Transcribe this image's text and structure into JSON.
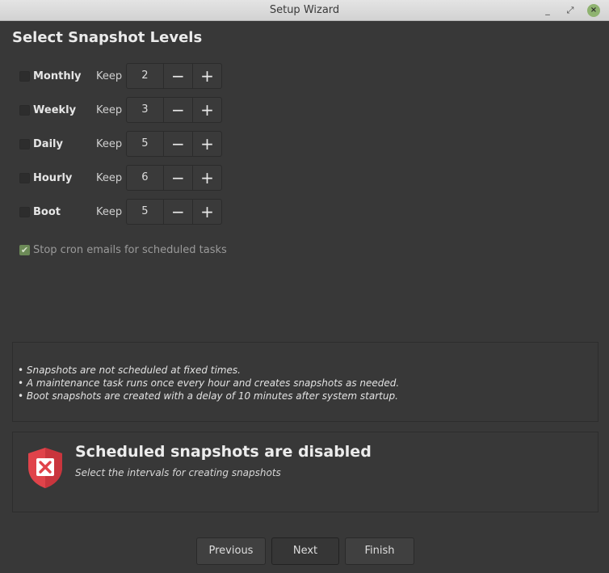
{
  "window": {
    "title": "Setup Wizard",
    "minimize_glyph": "_",
    "maximize_glyph": "⤢",
    "close_glyph": "×"
  },
  "heading": "Select Snapshot Levels",
  "levels": [
    {
      "label": "Monthly",
      "keep_label": "Keep",
      "value": "2",
      "checked": false
    },
    {
      "label": "Weekly",
      "keep_label": "Keep",
      "value": "3",
      "checked": false
    },
    {
      "label": "Daily",
      "keep_label": "Keep",
      "value": "5",
      "checked": false
    },
    {
      "label": "Hourly",
      "keep_label": "Keep",
      "value": "6",
      "checked": false
    },
    {
      "label": "Boot",
      "keep_label": "Keep",
      "value": "5",
      "checked": false
    }
  ],
  "spin_glyphs": {
    "minus": "−",
    "plus": "+"
  },
  "cron": {
    "label": "Stop cron emails for scheduled tasks",
    "checked": true,
    "disabled": true,
    "check_glyph": "✔"
  },
  "info_lines": [
    "• Snapshots are not scheduled at fixed times.",
    "• A maintenance task runs once every hour and creates snapshots as needed.",
    "• Boot snapshots are created with a delay of 10 minutes after system startup."
  ],
  "status": {
    "title": "Scheduled snapshots are disabled",
    "subtitle": "Select the intervals for creating snapshots",
    "icon": "shield-error-icon",
    "icon_color": "#e0434a"
  },
  "buttons": {
    "previous": "Previous",
    "next": "Next",
    "finish": "Finish"
  }
}
